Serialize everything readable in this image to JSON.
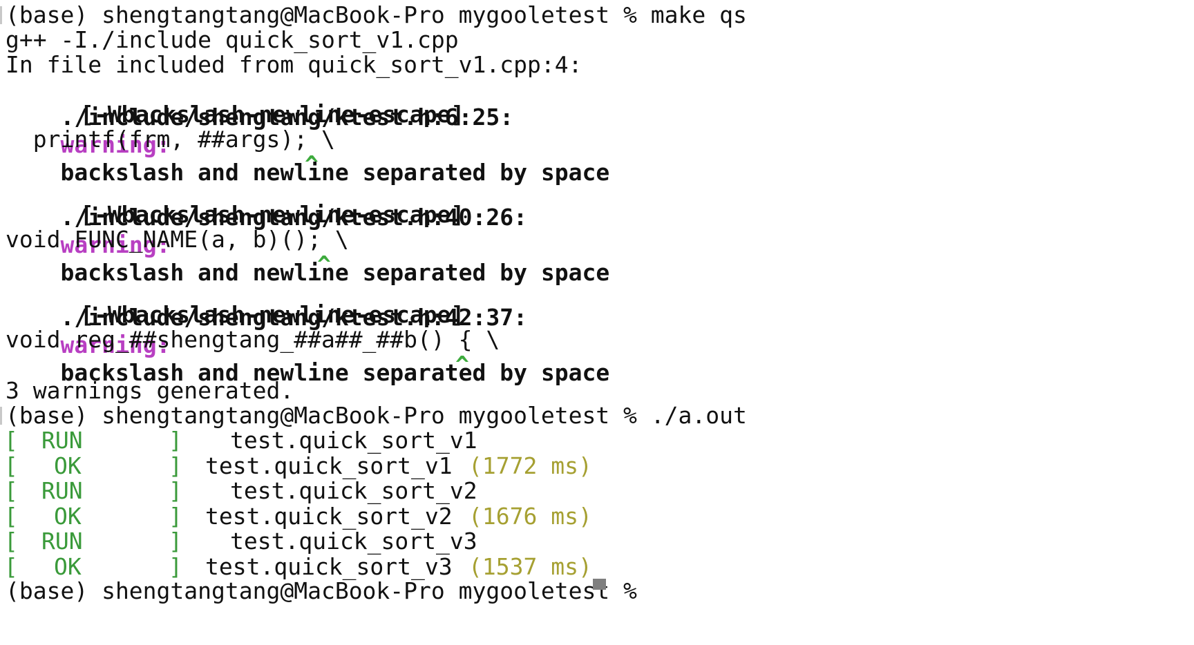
{
  "colors": {
    "warning": "#b83fc2",
    "caret": "#3eab3e",
    "test_bracket": "#3a9a3a",
    "timing": "#a6a032",
    "cursor": "#7f7f7f"
  },
  "terminal": {
    "prompt1": "(base) shengtangtang@MacBook-Pro mygooletest % make qs",
    "compile_cmd": "g++ -I./include quick_sort_v1.cpp",
    "included_from": "In file included from quick_sort_v1.cpp:4:",
    "warnings": [
      {
        "location": "./include/shengtang/ktest.h:6:25:",
        "label": "warning:",
        "message": "backslash and newline separated by space",
        "flag": "[-Wbackslash-newline-escape]",
        "source": "  printf(frm, ##args); \\",
        "caret": "^"
      },
      {
        "location": "./include/shengtang/ktest.h:40:26:",
        "label": "warning:",
        "message": "backslash and newline separated by space",
        "flag": "[-Wbackslash-newline-escape]",
        "source": "void FUNC_NAME(a, b)(); \\",
        "caret": "^"
      },
      {
        "location": "./include/shengtang/ktest.h:42:37:",
        "label": "warning:",
        "message": "backslash and newline separated by space",
        "flag": "[-Wbackslash-newline-escape]",
        "source": "void reg_##shengtang_##a##_##b() { \\",
        "caret": "^"
      }
    ],
    "summary": "3 warnings generated.",
    "prompt2": "(base) shengtangtang@MacBook-Pro mygooletest % ./a.out",
    "tests": [
      {
        "status": "RUN",
        "name": "test.quick_sort_v1",
        "time": ""
      },
      {
        "status": "OK",
        "name": "test.quick_sort_v1",
        "time": "(1772 ms)"
      },
      {
        "status": "RUN",
        "name": "test.quick_sort_v2",
        "time": ""
      },
      {
        "status": "OK",
        "name": "test.quick_sort_v2",
        "time": "(1676 ms)"
      },
      {
        "status": "RUN",
        "name": "test.quick_sort_v3",
        "time": ""
      },
      {
        "status": "OK",
        "name": "test.quick_sort_v3",
        "time": "(1537 ms)"
      }
    ],
    "prompt3": "(base) shengtangtang@MacBook-Pro mygooletest % "
  }
}
